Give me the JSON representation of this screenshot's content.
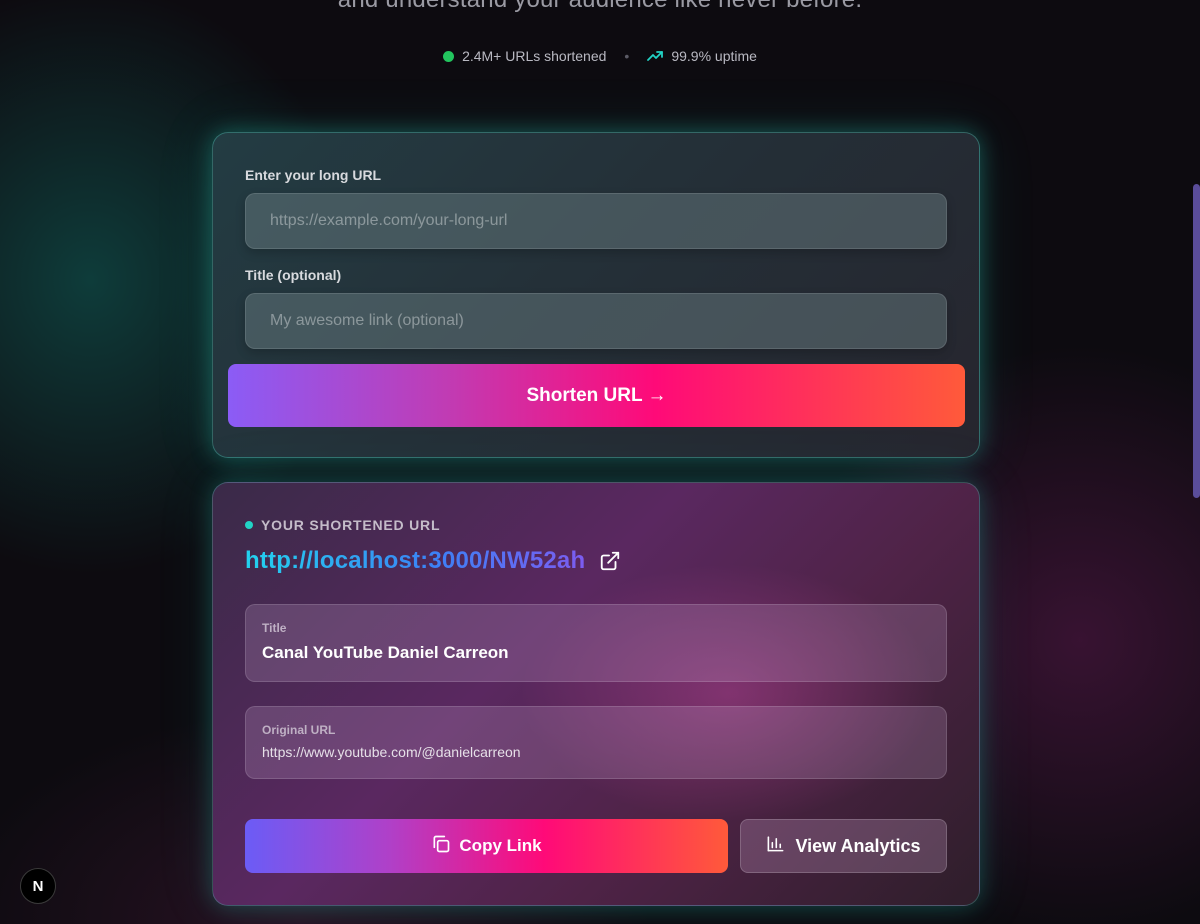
{
  "hero": {
    "tagline": "and understand your audience like never before."
  },
  "stats": {
    "urls_shortened": "2.4M+ URLs shortened",
    "separator": "•",
    "uptime": "99.9% uptime"
  },
  "form": {
    "url_label": "Enter your long URL",
    "url_placeholder": "https://example.com/your-long-url",
    "title_label": "Title (optional)",
    "title_placeholder": "My awesome link (optional)",
    "submit_label": "Shorten URL →"
  },
  "result": {
    "heading": "YOUR SHORTENED URL",
    "short_url": "http://localhost:3000/NW52ah",
    "title_key": "Title",
    "title_value": "Canal YouTube Daniel Carreon",
    "original_key": "Original URL",
    "original_value": "https://www.youtube.com/@danielcarreon",
    "copy_label": "Copy Link",
    "analytics_label": "View Analytics"
  },
  "badge": {
    "label": "N"
  },
  "colors": {
    "accent_teal": "#22d3c5",
    "status_green": "#22c55e",
    "gradient_start": "#8b5cf6",
    "gradient_mid": "#ff0a78",
    "gradient_end": "#ff5a3a"
  },
  "icons": [
    "status-dot-icon",
    "trending-up-icon",
    "external-link-icon",
    "copy-icon",
    "bar-chart-icon",
    "nextjs-icon"
  ]
}
